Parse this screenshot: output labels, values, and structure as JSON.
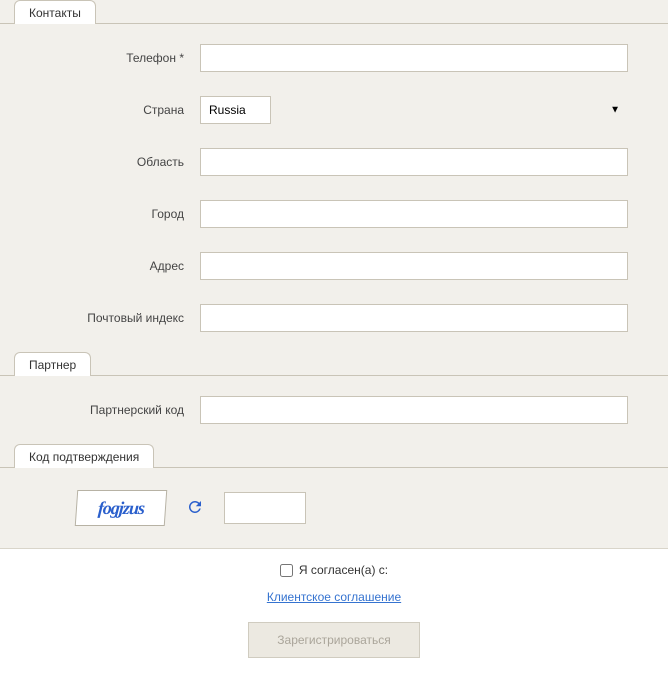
{
  "sections": {
    "contacts": {
      "title": "Контакты",
      "fields": {
        "phone": {
          "label": "Телефон *",
          "value": ""
        },
        "country": {
          "label": "Страна",
          "value": "Russia"
        },
        "region": {
          "label": "Область",
          "value": ""
        },
        "city": {
          "label": "Город",
          "value": ""
        },
        "address": {
          "label": "Адрес",
          "value": ""
        },
        "zip": {
          "label": "Почтовый индекс",
          "value": ""
        }
      }
    },
    "partner": {
      "title": "Партнер",
      "fields": {
        "code": {
          "label": "Партнерский код",
          "value": ""
        }
      }
    },
    "captcha": {
      "title": "Код подтверждения",
      "image_text": "fogjzus",
      "value": ""
    }
  },
  "agreement": {
    "checkbox_label": "Я согласен(а) с:",
    "link_text": "Клиентское соглашение",
    "checked": false
  },
  "submit": {
    "label": "Зарегистрироваться"
  }
}
